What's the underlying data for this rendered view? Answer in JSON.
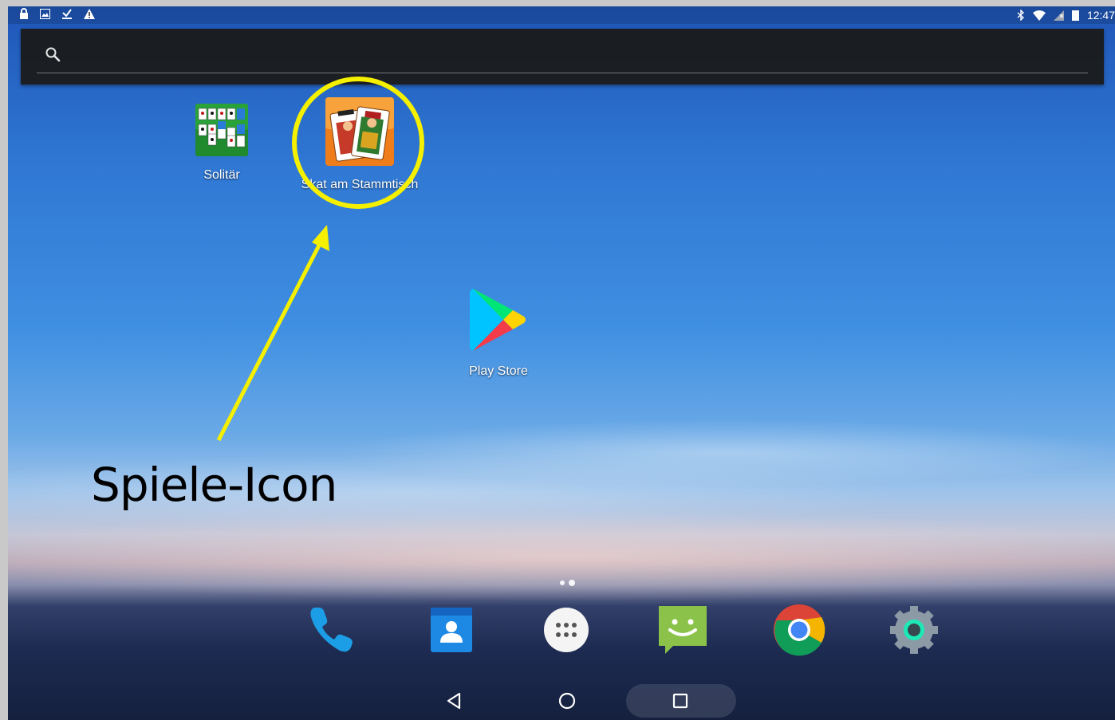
{
  "status_bar": {
    "left_icons": [
      "lock-icon",
      "image-icon",
      "download-done-icon",
      "warning-icon"
    ],
    "right_icons": [
      "bluetooth-icon",
      "wifi-icon",
      "no-signal-icon",
      "battery-icon"
    ],
    "time": "12:47"
  },
  "search": {
    "icon": "search-icon"
  },
  "apps": [
    {
      "id": "solitaer",
      "label": "Solitär",
      "icon": "solitaire-icon"
    },
    {
      "id": "skat",
      "label": "Skat am Stammtisch",
      "icon": "skat-cards-icon"
    },
    {
      "id": "playstore",
      "label": "Play Store",
      "icon": "play-store-icon"
    }
  ],
  "annotation": {
    "text": "Spiele-Icon",
    "color": "#f5ef00"
  },
  "dock": [
    {
      "name": "phone",
      "icon": "phone-icon"
    },
    {
      "name": "contacts",
      "icon": "contacts-icon"
    },
    {
      "name": "app-drawer",
      "icon": "app-drawer-icon"
    },
    {
      "name": "messages",
      "icon": "messages-icon"
    },
    {
      "name": "chrome",
      "icon": "chrome-icon"
    },
    {
      "name": "settings",
      "icon": "settings-icon"
    }
  ],
  "navigation": [
    "back-icon",
    "home-icon",
    "recents-icon"
  ]
}
